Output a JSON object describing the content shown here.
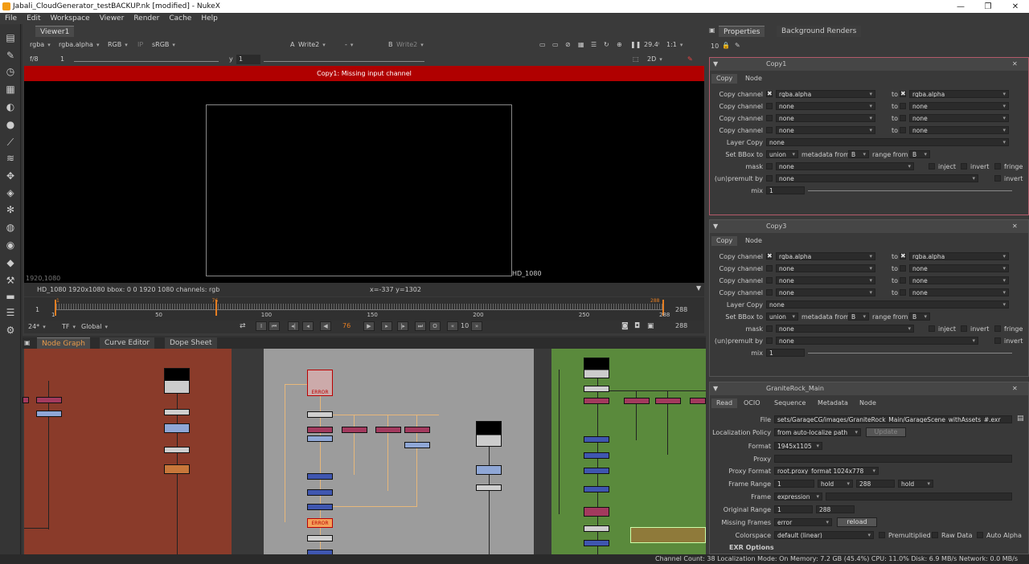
{
  "window": {
    "title": "Jabali_CloudGenerator_testBACKUP.nk [modified] - NukeX",
    "min": "—",
    "max": "❐",
    "close": "✕"
  },
  "menu": [
    "File",
    "Edit",
    "Workspace",
    "Viewer",
    "Render",
    "Cache",
    "Help"
  ],
  "viewer": {
    "tab": "Viewer1",
    "channels": "rgba",
    "alpha": "rgba.alpha",
    "rgb": "RGB",
    "ip": "IP",
    "lut": "sRGB",
    "a_label": "A",
    "a_input": "Write2",
    "dash": "-",
    "b_label": "B",
    "b_input": "Write2",
    "zoom": "29.4ⁱ",
    "ratio": "1:1",
    "fstop": "f/8",
    "gain": "1",
    "y_label": "y",
    "gamma": "1",
    "view_mode": "2D",
    "error": "Copy1: Missing input channel",
    "format_corner": "1920,1080",
    "format_label": "HD_1080",
    "info": "HD_1080 1920x1080  bbox: 0 0 1920 1080 channels: rgb",
    "coords": "x=-337 y=1302"
  },
  "timeline": {
    "start": "1",
    "end": "288",
    "current": "76",
    "ticks": [
      "50",
      "100",
      "150",
      "200",
      "250"
    ],
    "tick_values": [
      50,
      100,
      150,
      200,
      250
    ],
    "first": 1,
    "last": 288,
    "in_label": "1",
    "out_label": "288",
    "fps": "24*",
    "tf": "TF",
    "scope": "Global",
    "step": "10",
    "end_field": "288"
  },
  "nodegraph": {
    "tabs": [
      "Node Graph",
      "Curve Editor",
      "Dope Sheet"
    ],
    "error1": "ERROR",
    "error2": "ERROR"
  },
  "properties": {
    "tabs": [
      "Properties",
      "Background Renders"
    ],
    "count": "10",
    "copy1": {
      "name": "Copy1",
      "subtabs": [
        "Copy",
        "Node"
      ],
      "rows": [
        {
          "label": "Copy channel",
          "from": "rgba.alpha",
          "to": "rgba.alpha"
        },
        {
          "label": "Copy channel",
          "from": "none",
          "to": "none"
        },
        {
          "label": "Copy channel",
          "from": "none",
          "to": "none"
        },
        {
          "label": "Copy channel",
          "from": "none",
          "to": "none"
        }
      ],
      "layer_copy_label": "Layer Copy",
      "layer_copy": "none",
      "bbox_label": "Set BBox to",
      "bbox": "union",
      "metadata_label": "metadata from",
      "metadata": "B",
      "range_label": "range from",
      "range": "B",
      "mask_label": "mask",
      "mask": "none",
      "inject": "inject",
      "invert": "invert",
      "fringe": "fringe",
      "premult_label": "(un)premult by",
      "premult": "none",
      "invert2": "invert",
      "mix_label": "mix",
      "mix": "1",
      "mix_ticks": [
        "0.1",
        "0.2",
        "0.3",
        "0.4",
        "0.5",
        "0.6",
        "0.7",
        "0.8",
        "0.9"
      ]
    },
    "copy3": {
      "name": "Copy3",
      "subtabs": [
        "Copy",
        "Node"
      ],
      "rows": [
        {
          "label": "Copy channel",
          "from": "rgba.alpha",
          "to": "rgba.alpha"
        },
        {
          "label": "Copy channel",
          "from": "none",
          "to": "none"
        },
        {
          "label": "Copy channel",
          "from": "none",
          "to": "none"
        },
        {
          "label": "Copy channel",
          "from": "none",
          "to": "none"
        }
      ],
      "layer_copy_label": "Layer Copy",
      "layer_copy": "none",
      "bbox_label": "Set BBox to",
      "bbox": "union",
      "metadata_label": "metadata from",
      "metadata": "B",
      "range_label": "range from",
      "range": "B",
      "mask_label": "mask",
      "mask": "none",
      "inject": "inject",
      "invert": "invert",
      "fringe": "fringe",
      "premult_label": "(un)premult by",
      "premult": "none",
      "invert2": "invert",
      "mix_label": "mix",
      "mix": "1"
    },
    "read": {
      "name": "GraniteRock_Main",
      "subtabs": [
        "Read",
        "OCIO",
        "Sequence",
        "Metadata",
        "Node"
      ],
      "file_label": "File",
      "file": "sets/GarageCG/images/GraniteRock_Main/GarageScene_withAssets_#.exr",
      "loc_label": "Localization Policy",
      "loc": "from auto-localize path",
      "update": "Update",
      "format_label": "Format",
      "format": "1945x1105",
      "proxy_label": "Proxy",
      "proxy": "",
      "proxyfmt_label": "Proxy Format",
      "proxyfmt": "root.proxy_format 1024x778",
      "range_label": "Frame Range",
      "range_start": "1",
      "hold1": "hold",
      "range_end": "288",
      "hold2": "hold",
      "frame_label": "Frame",
      "frame": "expression",
      "orig_label": "Original Range",
      "orig_start": "1",
      "orig_end": "288",
      "missing_label": "Missing Frames",
      "missing": "error",
      "reload": "reload",
      "cs_label": "Colorspace",
      "cs": "default (linear)",
      "premultiplied": "Premultiplied",
      "raw": "Raw Data",
      "alpha": "Auto Alpha",
      "exr": "EXR Options"
    }
  },
  "status": "Channel Count: 38  Localization Mode: On  Memory: 7.2 GB (45.4%)  CPU: 11.0%  Disk: 6.9 MB/s  Network: 0.0 MB/s",
  "colors": {
    "error_red": "#b00000",
    "backdrop_left": "#8a3b2a",
    "backdrop_mid": "#9c9c9c",
    "backdrop_right": "#5a8a3c"
  }
}
